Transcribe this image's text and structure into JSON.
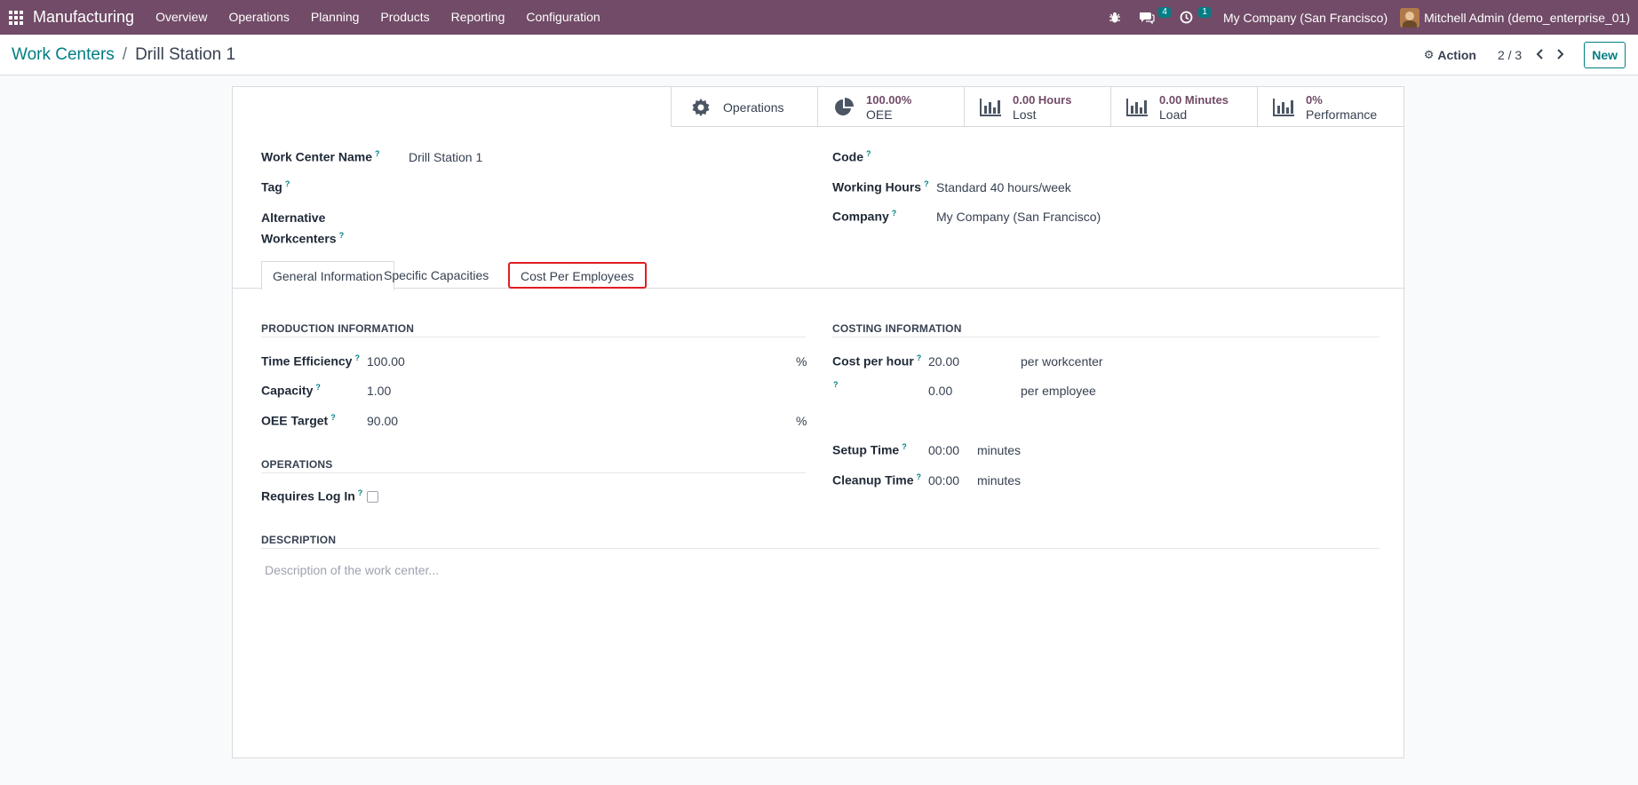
{
  "navbar": {
    "app_name": "Manufacturing",
    "menu": [
      "Overview",
      "Operations",
      "Planning",
      "Products",
      "Reporting",
      "Configuration"
    ],
    "messages_count": "4",
    "activities_count": "1",
    "company": "My Company (San Francisco)",
    "user": "Mitchell Admin (demo_enterprise_01)"
  },
  "control_panel": {
    "breadcrumb_parent": "Work Centers",
    "breadcrumb_sep": "/",
    "breadcrumb_current": "Drill Station 1",
    "action_label": "Action",
    "pager": "2 / 3",
    "new_label": "New"
  },
  "stat_buttons": [
    {
      "value": "",
      "label": "Operations",
      "icon": "gear-icon"
    },
    {
      "value": "100.00%",
      "label": "OEE",
      "icon": "pie-chart-icon"
    },
    {
      "value": "0.00 Hours",
      "label": "Lost",
      "icon": "bar-chart-icon"
    },
    {
      "value": "0.00 Minutes",
      "label": "Load",
      "icon": "bar-chart-icon"
    },
    {
      "value": "0%",
      "label": "Performance",
      "icon": "bar-chart-icon"
    }
  ],
  "fields": {
    "work_center_name_label": "Work Center Name",
    "work_center_name": "Drill Station 1",
    "tag_label": "Tag",
    "alt_workcenters_label_1": "Alternative",
    "alt_workcenters_label_2": "Workcenters",
    "code_label": "Code",
    "working_hours_label": "Working Hours",
    "working_hours": "Standard 40 hours/week",
    "company_label": "Company",
    "company": "My Company (San Francisco)",
    "help_mark": "?"
  },
  "tabs": [
    "General Information",
    "Specific Capacities",
    "Cost Per Employees"
  ],
  "production": {
    "title": "PRODUCTION INFORMATION",
    "time_efficiency_label": "Time Efficiency",
    "time_efficiency": "100.00",
    "capacity_label": "Capacity",
    "capacity": "1.00",
    "oee_target_label": "OEE Target",
    "oee_target": "90.00",
    "percent": "%"
  },
  "operations": {
    "title": "OPERATIONS",
    "requires_login_label": "Requires Log In",
    "requires_login": false
  },
  "costing": {
    "title": "COSTING INFORMATION",
    "cost_per_hour_label": "Cost per hour",
    "cost_per_hour": "20.00",
    "per_workcenter": "per workcenter",
    "employee_cost": "0.00",
    "per_employee": "per employee",
    "setup_time_label": "Setup Time",
    "setup_time": "00:00",
    "cleanup_time_label": "Cleanup Time",
    "cleanup_time": "00:00",
    "minutes": "minutes"
  },
  "description": {
    "title": "DESCRIPTION",
    "placeholder": "Description of the work center..."
  }
}
